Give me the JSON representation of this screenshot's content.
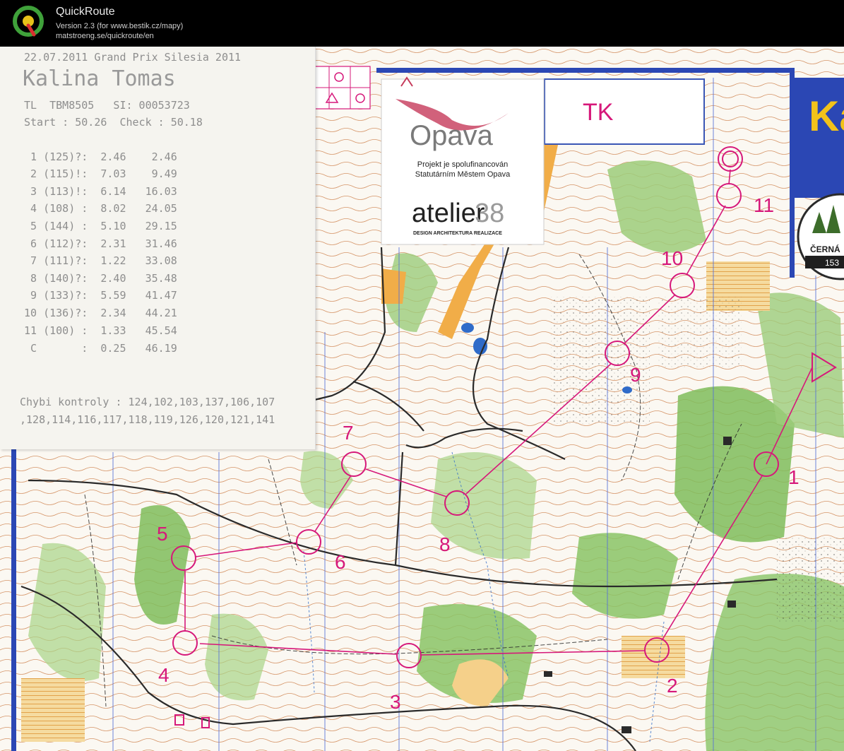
{
  "app": {
    "title": "QuickRoute",
    "version": "Version 2.3  (for www.bestik.cz/mapy)",
    "url": "matstroeng.se/quickroute/en"
  },
  "receipt": {
    "header": "22.07.2011 Grand Prix Silesia 2011",
    "name": "Kalina Tomas",
    "club_line": "TL  TBM8505   SI: 00053723",
    "start_line": "Start : 50.26  Check : 50.18",
    "splits": [
      " 1 (125)?:  2.46    2.46",
      " 2 (115)!:  7.03    9.49",
      " 3 (113)!:  6.14   16.03",
      " 4 (108) :  8.02   24.05",
      " 5 (144) :  5.10   29.15",
      " 6 (112)?:  2.31   31.46",
      " 7 (111)?:  1.22   33.08",
      " 8 (140)?:  2.40   35.48",
      " 9 (133)?:  5.59   41.47",
      "10 (136)?:  2.34   44.21",
      "11 (100) :  1.33   45.54",
      " C       :  0.25   46.19"
    ],
    "missing_line1": "Chybi kontroly : 124,102,103,137,106,107",
    "missing_line2": ",128,114,116,117,118,119,126,120,121,141"
  },
  "sponsor": {
    "city": "Opava",
    "text_line1": "Projekt je spolufinancován",
    "text_line2": "Statutárním Městem Opava",
    "brand": "atelier",
    "brand_num": "38",
    "brand_sub": "DESIGN ARCHITEKTURA REALIZACE"
  },
  "map_labels": {
    "tk": "TK",
    "corner_text": "Ka",
    "badge_text": "ČERNÁ",
    "badge_num": "153"
  },
  "controls": [
    {
      "label": "1"
    },
    {
      "label": "2"
    },
    {
      "label": "3"
    },
    {
      "label": "4"
    },
    {
      "label": "5"
    },
    {
      "label": "6"
    },
    {
      "label": "7"
    },
    {
      "label": "8"
    },
    {
      "label": "9"
    },
    {
      "label": "10"
    },
    {
      "label": "11"
    }
  ],
  "colors": {
    "course": "#d6187a",
    "forest": "#7fbd5c",
    "contour": "#c56a2c",
    "open_land": "#f1ad48",
    "north_lines": "#5570d8",
    "border_blue": "#2b47b4"
  }
}
